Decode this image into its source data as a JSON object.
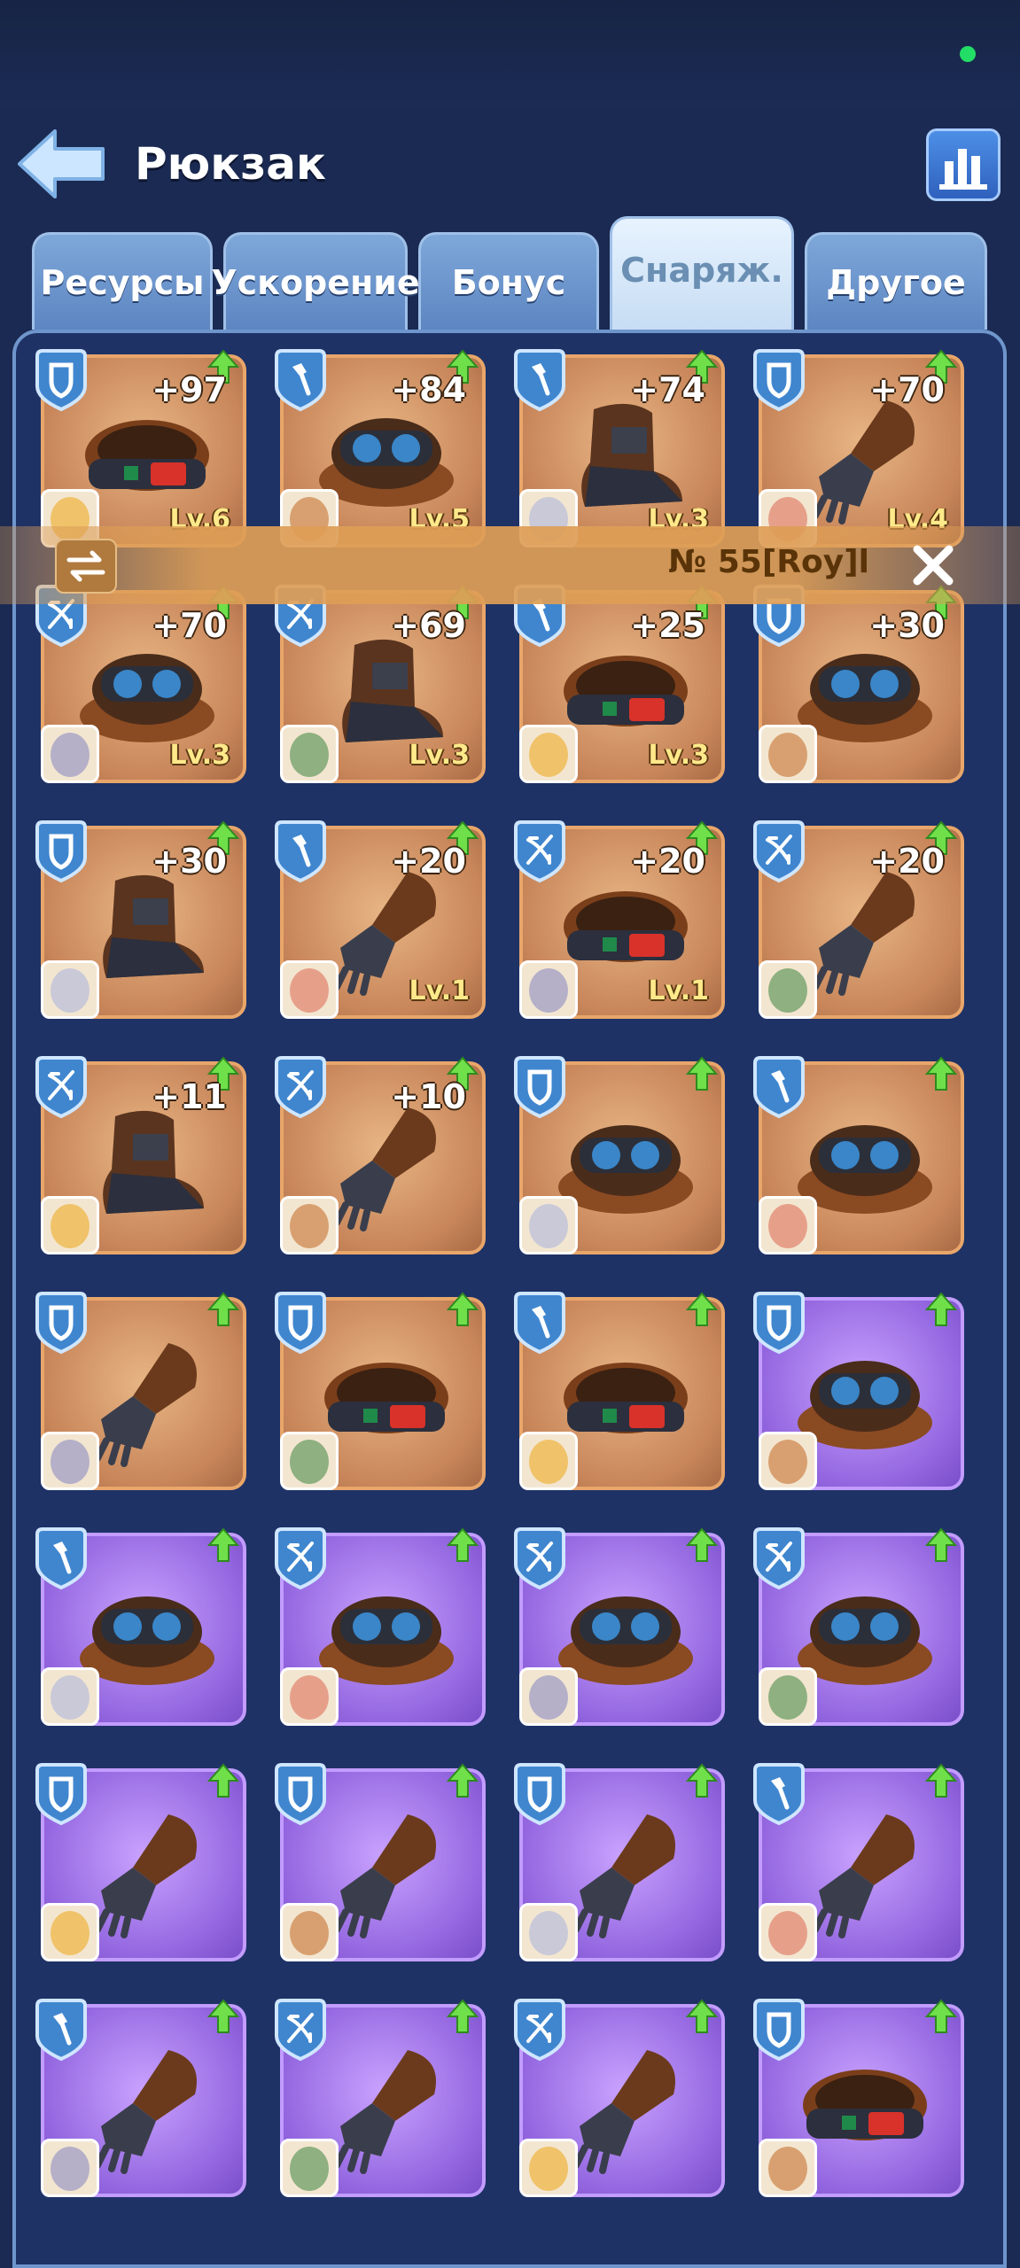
{
  "header": {
    "title": "Рюкзак"
  },
  "tabs": [
    {
      "label": "Ресурсы",
      "active": false
    },
    {
      "label": "Ускорение",
      "active": false
    },
    {
      "label": "Бонус",
      "active": false
    },
    {
      "label": "Снаряж.",
      "active": true
    },
    {
      "label": "Другое",
      "active": false
    }
  ],
  "owner_bar": {
    "text": "№ 55[Roy]l"
  },
  "colors": {
    "brown_card": "#c8865a",
    "purple_card": "#9467e0",
    "bonus_text": "#ffffff",
    "level_text": "#ffe98a"
  },
  "items": [
    {
      "type": "shield",
      "rarity": "brown",
      "bonus": "+97",
      "level": "Lv.6",
      "gear": "belt"
    },
    {
      "type": "shovel",
      "rarity": "brown",
      "bonus": "+84",
      "level": "Lv.5",
      "gear": "goggles"
    },
    {
      "type": "shovel",
      "rarity": "brown",
      "bonus": "+74",
      "level": "Lv.3",
      "gear": "boot"
    },
    {
      "type": "shield",
      "rarity": "brown",
      "bonus": "+70",
      "level": "Lv.4",
      "gear": "glove"
    },
    {
      "type": "crossbow",
      "rarity": "brown",
      "bonus": "+70",
      "level": "Lv.3",
      "gear": "goggles"
    },
    {
      "type": "crossbow",
      "rarity": "brown",
      "bonus": "+69",
      "level": "Lv.3",
      "gear": "boot"
    },
    {
      "type": "shovel",
      "rarity": "brown",
      "bonus": "+25",
      "level": "Lv.3",
      "gear": "belt"
    },
    {
      "type": "shield",
      "rarity": "brown",
      "bonus": "+30",
      "level": "",
      "gear": "goggles"
    },
    {
      "type": "shield",
      "rarity": "brown",
      "bonus": "+30",
      "level": "",
      "gear": "boot"
    },
    {
      "type": "shovel",
      "rarity": "brown",
      "bonus": "+20",
      "level": "Lv.1",
      "gear": "glove"
    },
    {
      "type": "crossbow",
      "rarity": "brown",
      "bonus": "+20",
      "level": "Lv.1",
      "gear": "belt"
    },
    {
      "type": "crossbow",
      "rarity": "brown",
      "bonus": "+20",
      "level": "",
      "gear": "glove"
    },
    {
      "type": "crossbow",
      "rarity": "brown",
      "bonus": "+11",
      "level": "",
      "gear": "boot"
    },
    {
      "type": "crossbow",
      "rarity": "brown",
      "bonus": "+10",
      "level": "",
      "gear": "glove"
    },
    {
      "type": "shield",
      "rarity": "brown",
      "bonus": "",
      "level": "",
      "gear": "goggles"
    },
    {
      "type": "shovel",
      "rarity": "brown",
      "bonus": "",
      "level": "",
      "gear": "goggles"
    },
    {
      "type": "shield",
      "rarity": "brown",
      "bonus": "",
      "level": "",
      "gear": "glove"
    },
    {
      "type": "shield",
      "rarity": "brown",
      "bonus": "",
      "level": "",
      "gear": "belt"
    },
    {
      "type": "shovel",
      "rarity": "brown",
      "bonus": "",
      "level": "",
      "gear": "belt"
    },
    {
      "type": "shield",
      "rarity": "purple",
      "bonus": "",
      "level": "",
      "gear": "goggles"
    },
    {
      "type": "shovel",
      "rarity": "purple",
      "bonus": "",
      "level": "",
      "gear": "goggles"
    },
    {
      "type": "crossbow",
      "rarity": "purple",
      "bonus": "",
      "level": "",
      "gear": "goggles"
    },
    {
      "type": "crossbow",
      "rarity": "purple",
      "bonus": "",
      "level": "",
      "gear": "goggles"
    },
    {
      "type": "crossbow",
      "rarity": "purple",
      "bonus": "",
      "level": "",
      "gear": "goggles"
    },
    {
      "type": "shield",
      "rarity": "purple",
      "bonus": "",
      "level": "",
      "gear": "glove"
    },
    {
      "type": "shield",
      "rarity": "purple",
      "bonus": "",
      "level": "",
      "gear": "glove"
    },
    {
      "type": "shield",
      "rarity": "purple",
      "bonus": "",
      "level": "",
      "gear": "glove"
    },
    {
      "type": "shovel",
      "rarity": "purple",
      "bonus": "",
      "level": "",
      "gear": "glove"
    },
    {
      "type": "shovel",
      "rarity": "purple",
      "bonus": "",
      "level": "",
      "gear": "glove"
    },
    {
      "type": "crossbow",
      "rarity": "purple",
      "bonus": "",
      "level": "",
      "gear": "glove"
    },
    {
      "type": "crossbow",
      "rarity": "purple",
      "bonus": "",
      "level": "",
      "gear": "glove"
    },
    {
      "type": "shield",
      "rarity": "purple",
      "bonus": "",
      "level": "",
      "gear": "belt"
    }
  ]
}
